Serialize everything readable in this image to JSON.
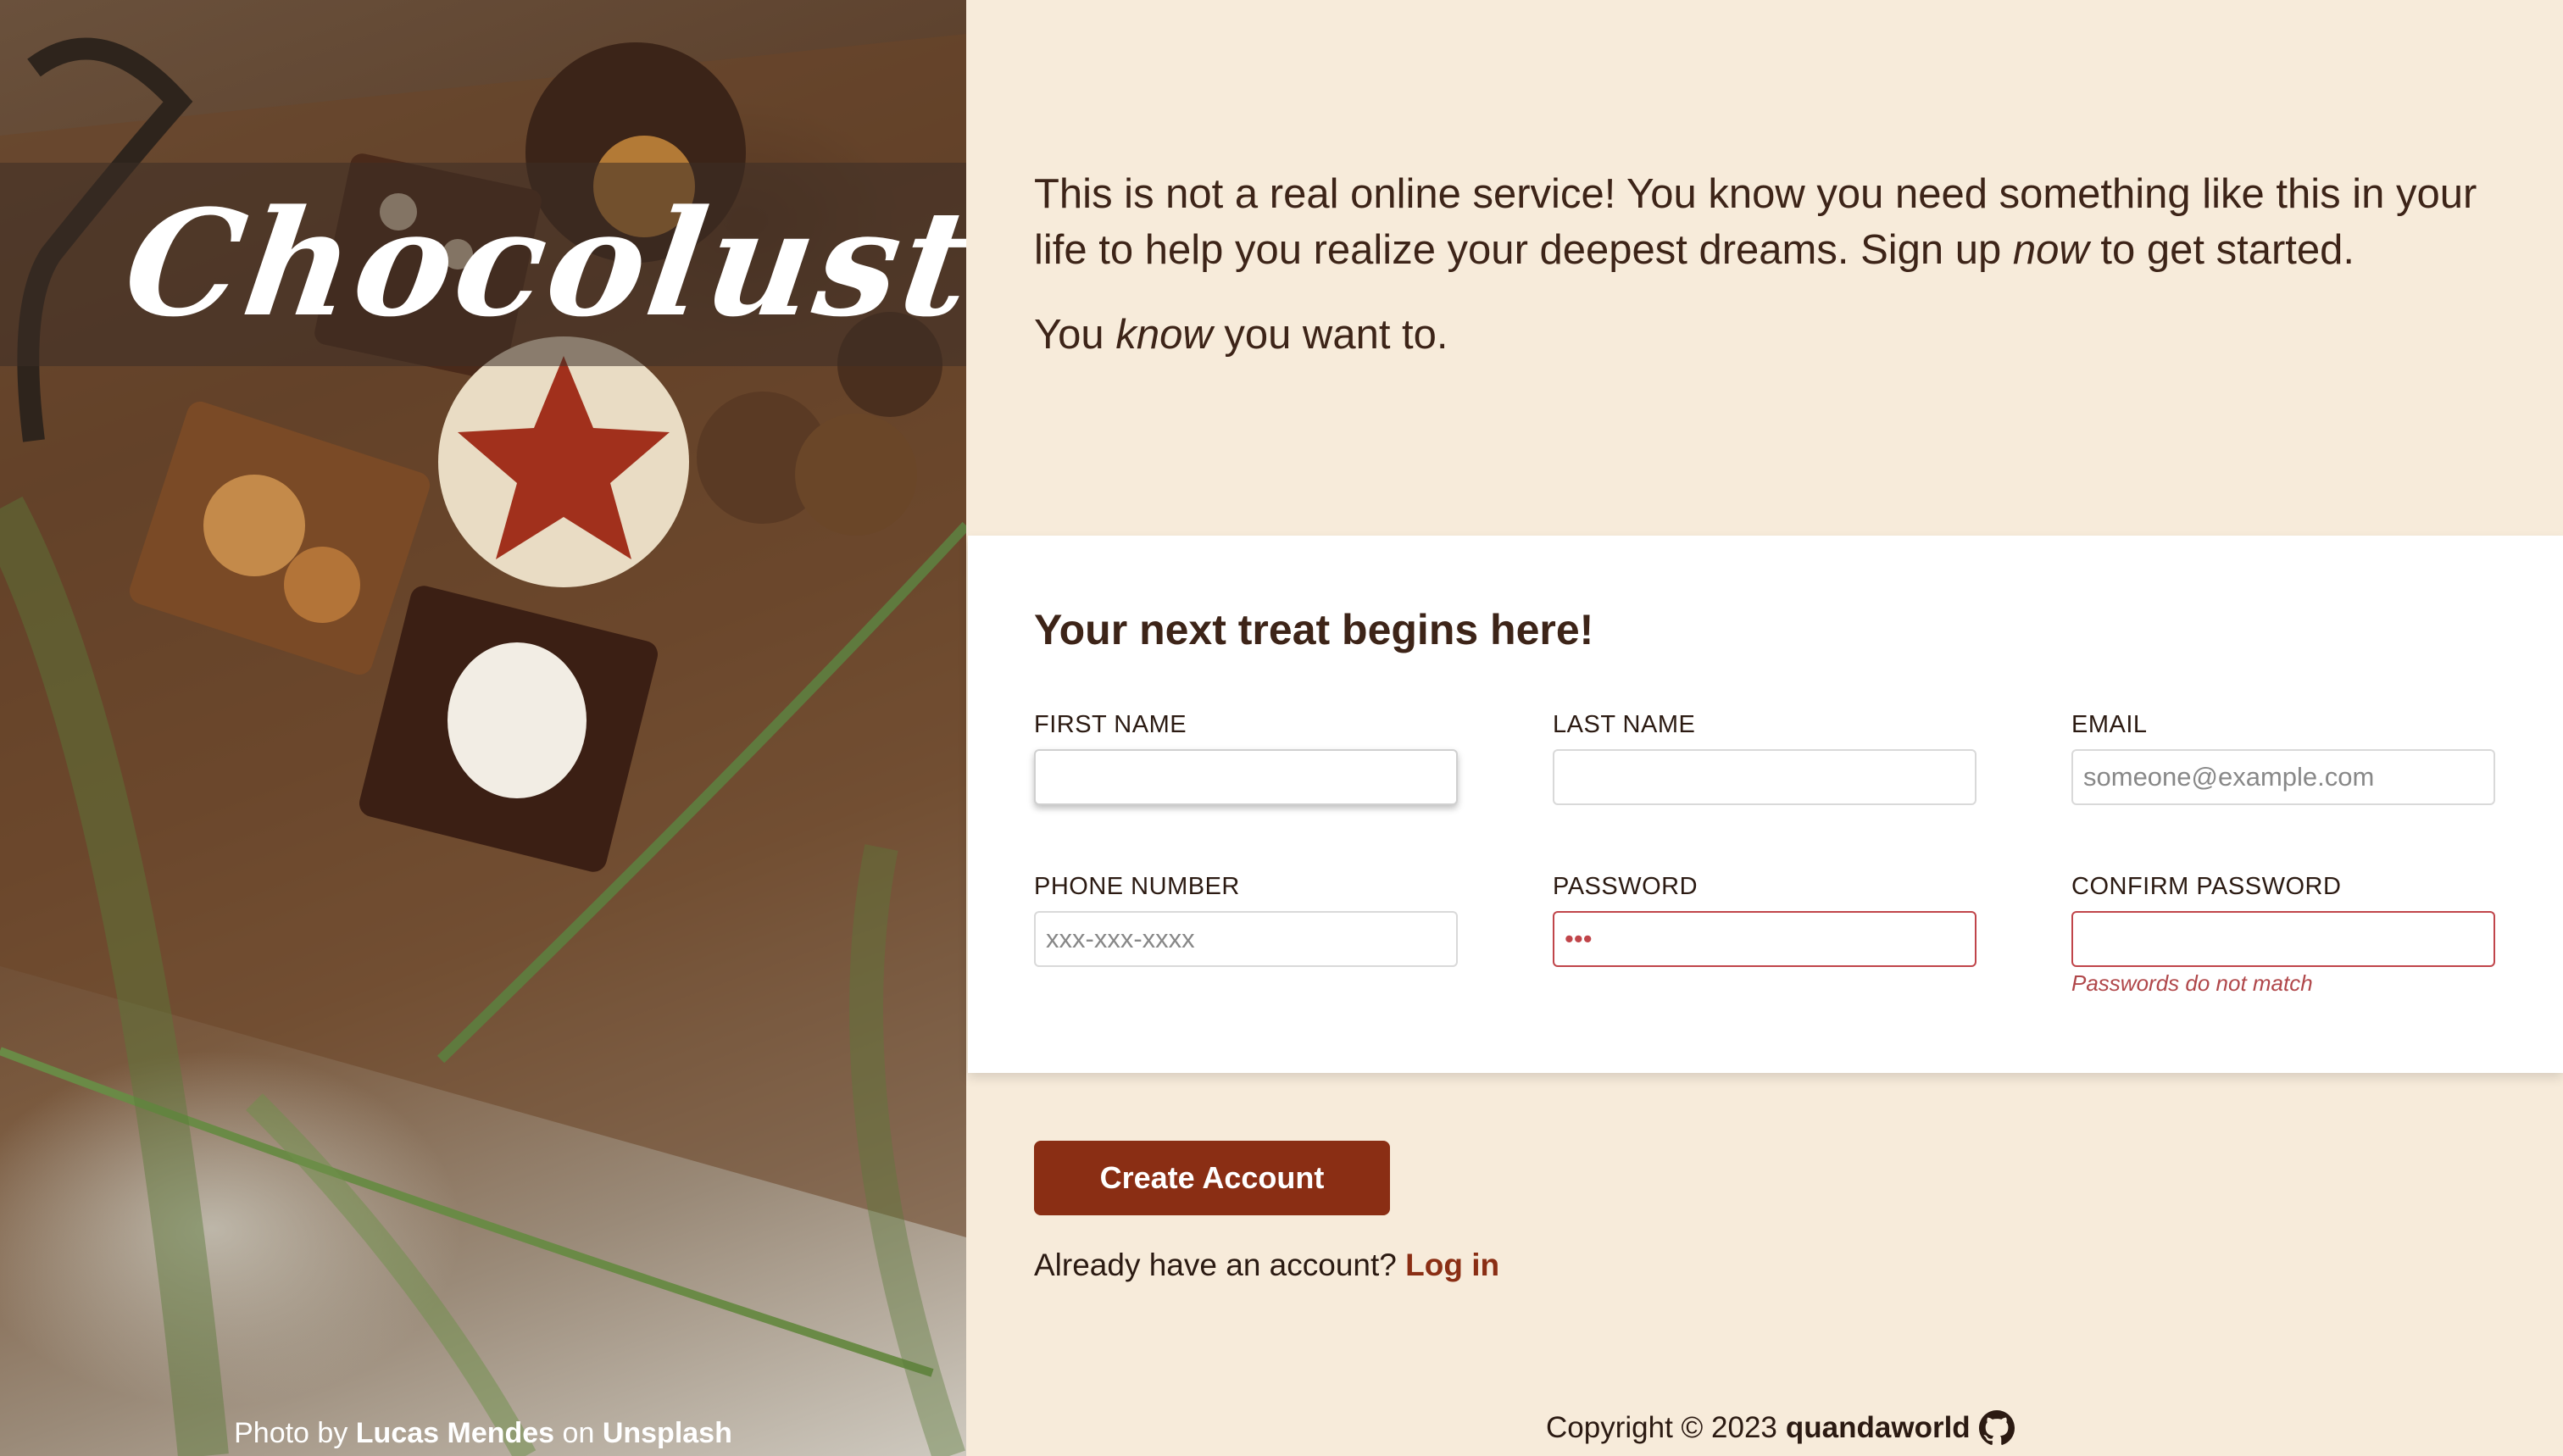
{
  "photo": {
    "logo": "Chocolust",
    "credit_prefix": "Photo by",
    "credit_author": "Lucas Mendes",
    "credit_mid": "on",
    "credit_site": "Unsplash"
  },
  "intro": {
    "p1_before": "This is not a real online service! You know you need something like this in your life to help you realize your deepest dreams. Sign up ",
    "p1_emph": "now",
    "p1_after": " to get started.",
    "p2_before": "You ",
    "p2_emph": "know",
    "p2_after": " you want to."
  },
  "form": {
    "heading": "Your next treat begins here!",
    "first_name": {
      "label": "FIRST NAME",
      "value": "",
      "placeholder": ""
    },
    "last_name": {
      "label": "LAST NAME",
      "value": "",
      "placeholder": ""
    },
    "email": {
      "label": "EMAIL",
      "value": "",
      "placeholder": "someone@example.com"
    },
    "phone": {
      "label": "PHONE NUMBER",
      "value": "",
      "placeholder": "xxx-xxx-xxxx"
    },
    "password": {
      "label": "PASSWORD",
      "value": "abc",
      "placeholder": ""
    },
    "confirm_password": {
      "label": "CONFIRM PASSWORD",
      "value": "",
      "placeholder": "",
      "error": "Passwords do not match"
    }
  },
  "actions": {
    "create_label": "Create Account",
    "login_prompt": "Already have an account?",
    "login_link": "Log in"
  },
  "footer": {
    "copyright": "Copyright © 2023",
    "author": "quandaworld",
    "icon": "github-icon"
  },
  "colors": {
    "background": "#f7ebda",
    "accent": "#8a2e14",
    "text": "#3d2418",
    "error": "#c0454a"
  }
}
